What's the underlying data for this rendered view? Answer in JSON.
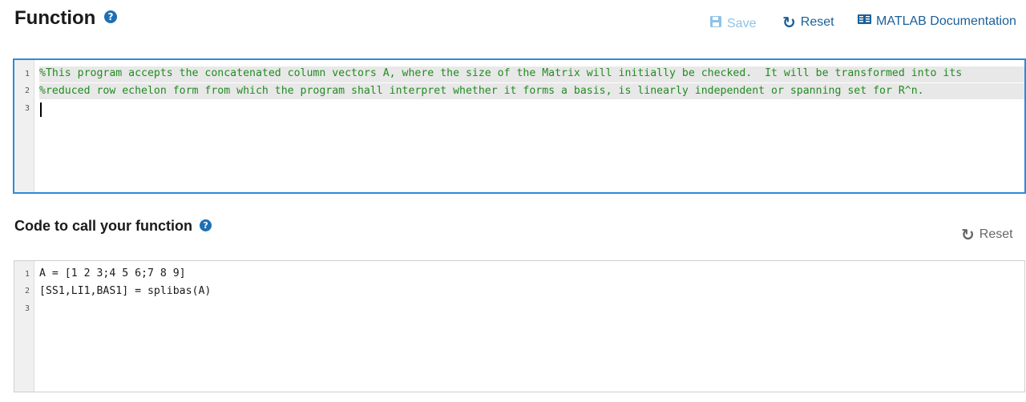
{
  "function_section": {
    "title": "Function",
    "toolbar": {
      "save_label": "Save",
      "reset_label": "Reset",
      "doc_label": "MATLAB Documentation"
    },
    "editor": {
      "line_numbers": [
        "1",
        "2",
        "3"
      ],
      "lines": [
        "%This program accepts the concatenated column vectors A, where the size of the Matrix will initially be checked.  It will be transformed into its",
        "%reduced row echelon form from which the program shall interpret whether it forms a basis, is linearly independent or spanning set for R^n.",
        ""
      ]
    }
  },
  "call_section": {
    "title": "Code to call your function",
    "reset_label": "Reset",
    "editor": {
      "line_numbers": [
        "1",
        "2",
        "3"
      ],
      "lines": [
        "A = [1 2 3;4 5 6;7 8 9]",
        "[SS1,LI1,BAS1] = splibas(A)",
        ""
      ]
    }
  },
  "icons": {
    "help": "question-circle-icon",
    "save": "floppy-disk-icon",
    "reset": "refresh-icon",
    "documentation": "book-icon"
  },
  "colors": {
    "accent_blue": "#1b5f99",
    "editor_focus_border": "#2e8bd8",
    "comment_green": "#228b22",
    "disabled_save": "#8fc2e6"
  }
}
